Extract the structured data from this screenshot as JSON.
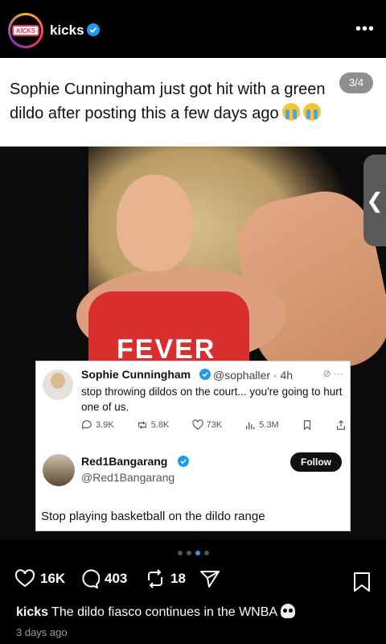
{
  "header": {
    "username": "kicks",
    "avatar_logo_text": "KICKS",
    "more_label": "•••"
  },
  "caption_card": {
    "text": "Sophie Cunningham just got hit with a green dildo after posting this a few days ago",
    "page_indicator": "3/4"
  },
  "photo": {
    "jersey_text": "FEVER",
    "side_tab_label": "❮"
  },
  "tweet": {
    "author_name": "Sophie Cunningham",
    "author_handle": "@sophaller · 4h",
    "body": "stop throwing dildos on the court... you're going to hurt one of us.",
    "replies": "3.9K",
    "retweets": "5.8K",
    "likes": "73K",
    "views": "5.3M",
    "reply_name": "Red1Bangarang",
    "reply_handle": "@Red1Bangarang",
    "follow_label": "Follow",
    "reply_body": "Stop playing basketball on the dildo range"
  },
  "carousel": {
    "count": 4,
    "active_index": 2
  },
  "actions": {
    "likes": "16K",
    "comments": "403",
    "reposts": "18"
  },
  "post": {
    "username": "kicks",
    "caption": "The dildo fiasco continues in the WNBA",
    "timestamp": "3 days ago"
  },
  "colors": {
    "accent": "#3897f0",
    "verified": "#1d9bf0",
    "jersey": "#d92e2e"
  }
}
